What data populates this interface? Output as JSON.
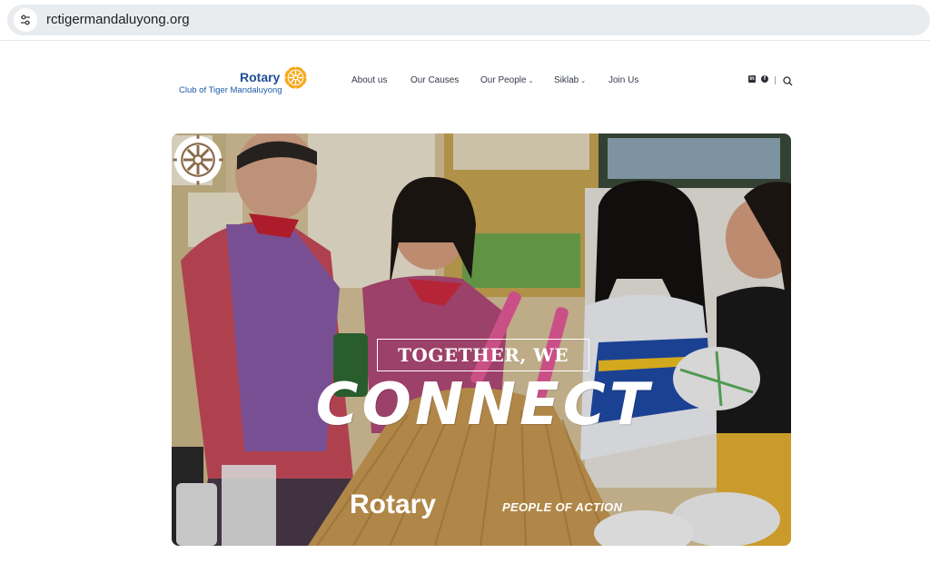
{
  "browser": {
    "url": "rctigermandaluyong.org"
  },
  "header": {
    "logo": {
      "brand": "Rotary",
      "subtitle": "Club of Tiger Mandaluyong"
    },
    "nav": [
      {
        "label": "About us",
        "has_dropdown": false
      },
      {
        "label": "Our Causes",
        "has_dropdown": false
      },
      {
        "label": "Our People",
        "has_dropdown": true
      },
      {
        "label": "Siklab",
        "has_dropdown": true
      },
      {
        "label": "Join Us",
        "has_dropdown": false
      }
    ],
    "social_icons": [
      "linkedin-icon",
      "facebook-icon"
    ],
    "search_icon": "search-icon"
  },
  "hero": {
    "tagline": "TOGETHER, WE",
    "headline": "CONNECT",
    "brand": "Rotary",
    "brand_tagline": "PEOPLE OF ACTION",
    "colors": {
      "rotary_blue": "#1f4e96",
      "rotary_gold": "#f7a81b"
    }
  }
}
